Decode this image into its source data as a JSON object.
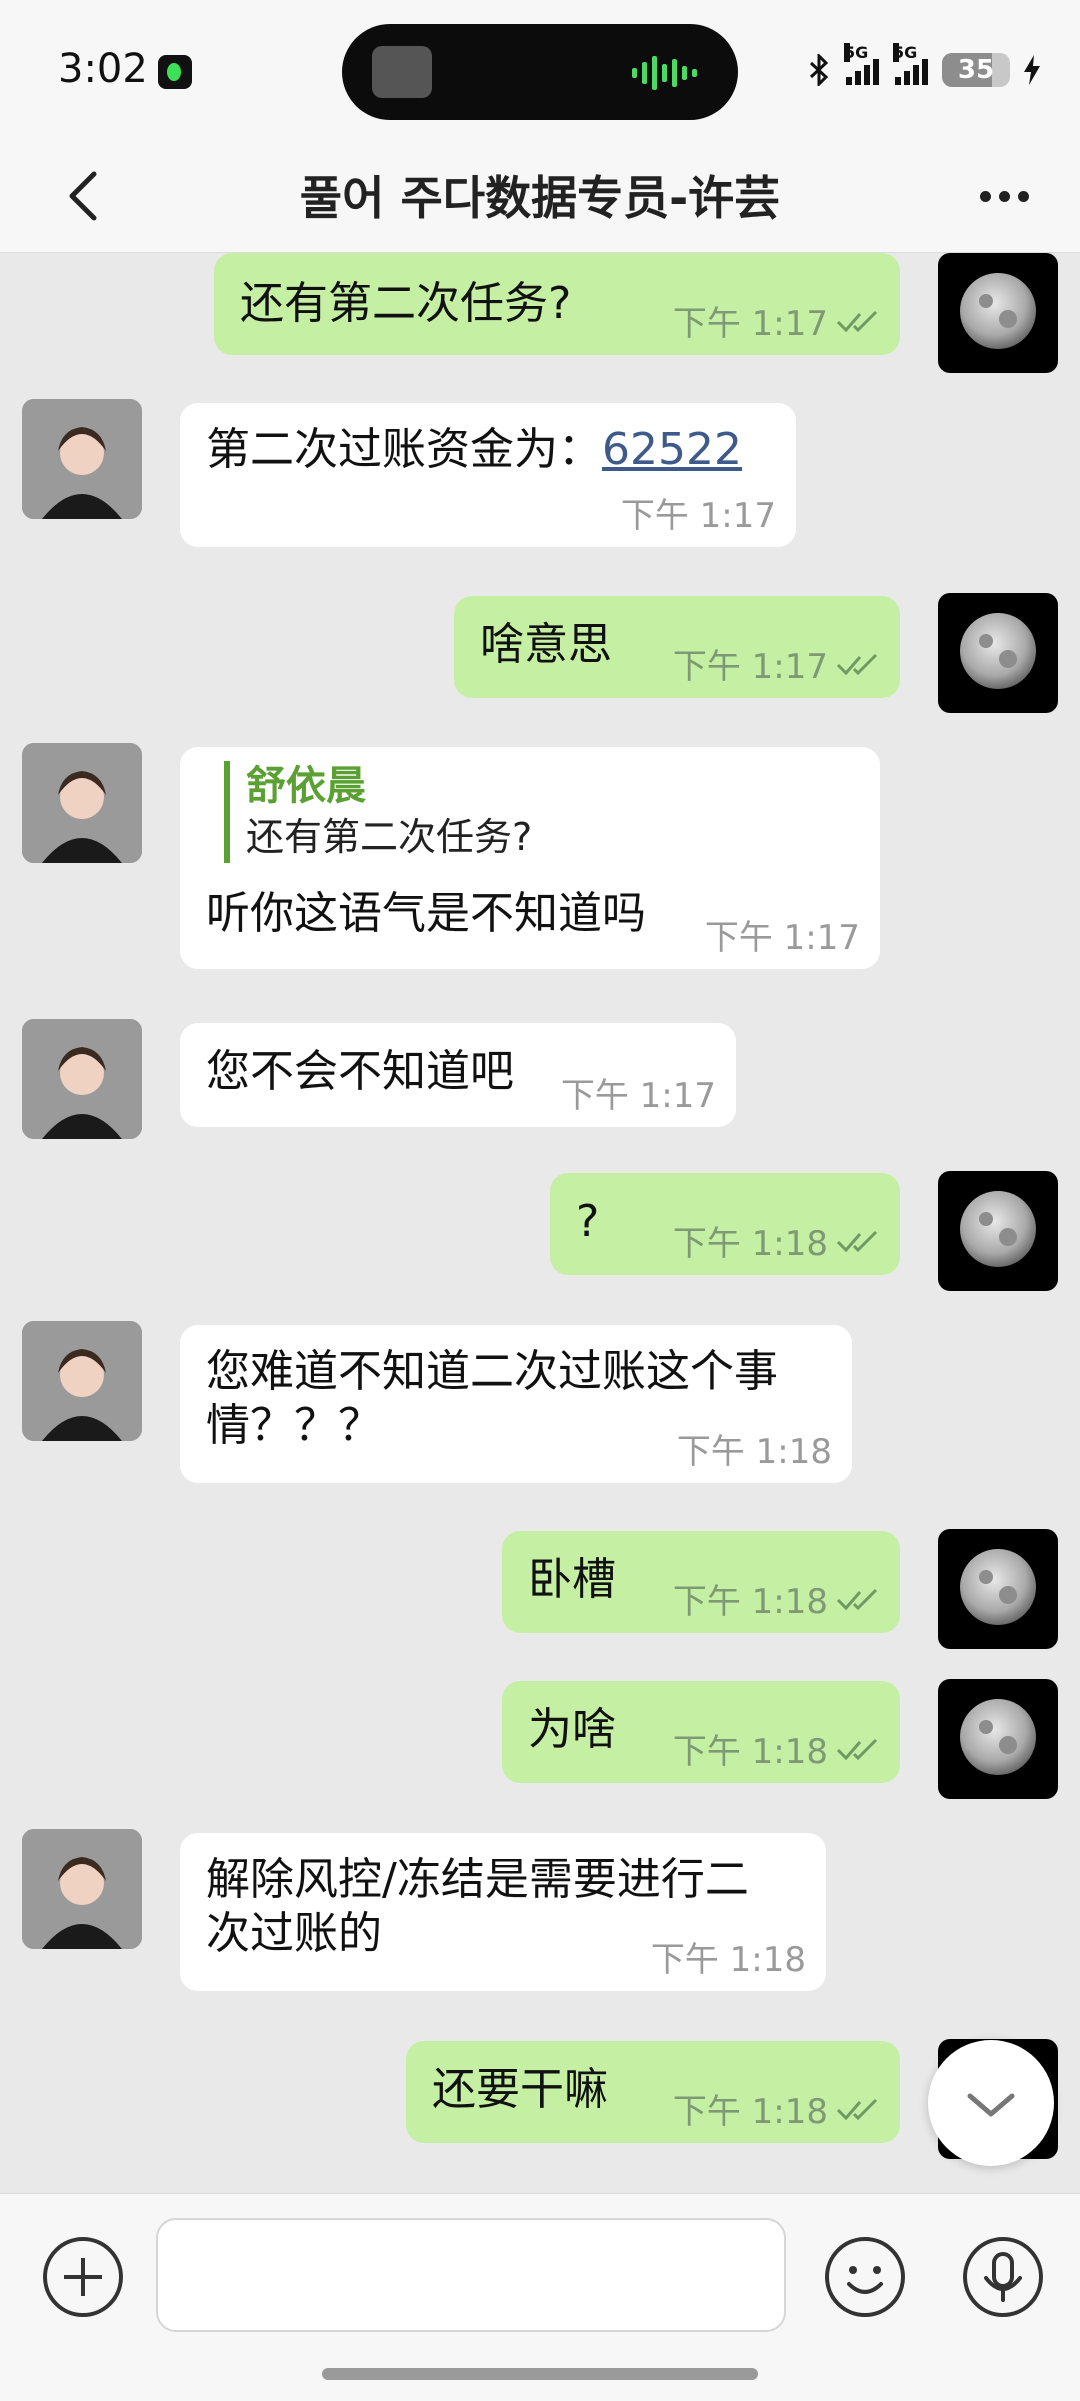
{
  "status": {
    "time": "3:02",
    "net1": "5G",
    "net2": "5G",
    "battery": "35"
  },
  "header": {
    "title": "풀어 주다数据专员-许芸"
  },
  "messages": [
    {
      "text": "还有第二次任务?",
      "time": "下午 1:17"
    },
    {
      "prefix": "第二次过账资金为：",
      "link": "62522",
      "time": "下午 1:17"
    },
    {
      "text": "啥意思",
      "time": "下午 1:17"
    },
    {
      "quote_name": "舒依晨",
      "quote_text": "还有第二次任务?",
      "text": "听你这语气是不知道吗",
      "time": "下午 1:17"
    },
    {
      "text": "您不会不知道吧",
      "time": "下午 1:17"
    },
    {
      "text": "?",
      "time": "下午 1:18"
    },
    {
      "line1": "您难道不知道二次过账这个事",
      "line2": "情？？？",
      "time": "下午 1:18"
    },
    {
      "text": "卧槽",
      "time": "下午 1:18"
    },
    {
      "text": "为啥",
      "time": "下午 1:18"
    },
    {
      "line1": "解除风控/冻结是需要进行二",
      "line2": "次过账的",
      "time": "下午 1:18"
    },
    {
      "text": "还要干嘛",
      "time": "下午 1:18"
    }
  ],
  "input": {
    "placeholder": ""
  }
}
